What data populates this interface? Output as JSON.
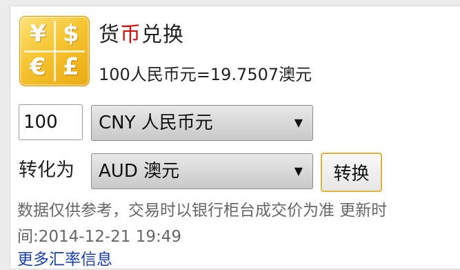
{
  "app": {
    "title_part1": "货",
    "title_accent": "币",
    "title_part2": "兑换",
    "accent_color": "#cc1111",
    "rate_text": "100人民币元=19.7507澳元"
  },
  "icon": {
    "name": "currency-exchange-icon",
    "symbols": [
      "¥",
      "$",
      "€",
      "£"
    ]
  },
  "form": {
    "amount_value": "100",
    "from_currency": "CNY 人民币元",
    "to_label": "转化为",
    "to_currency": "AUD 澳元",
    "convert_label": "转换"
  },
  "footer": {
    "disclaimer_line1": "数据仅供参考，交易时以银行柜台成交价为准 更新时",
    "disclaimer_line2": "间:2014-12-21 19:49",
    "more_link": "更多汇率信息"
  }
}
